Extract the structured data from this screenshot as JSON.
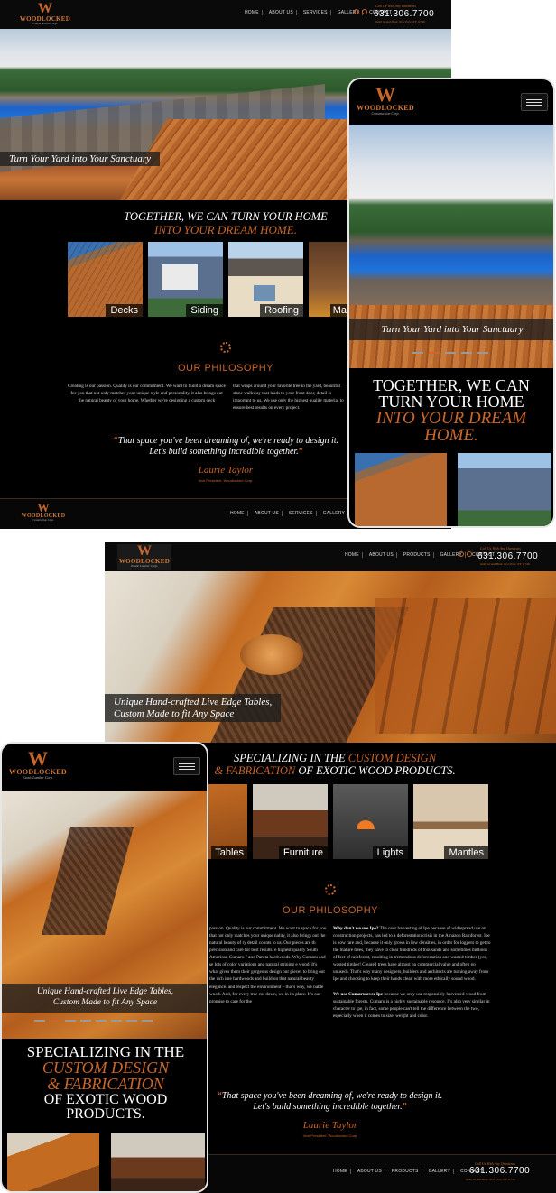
{
  "colors": {
    "accent": "#c9662a",
    "background": "#000000"
  },
  "logo": {
    "initial": "W",
    "name": "WOODLOCKED",
    "sub_construction": "Construction Corp.",
    "sub_lumber": "Exotic Lumber Corp."
  },
  "nav": {
    "items": [
      "HOME",
      "ABOUT US",
      "SERVICES",
      "GALLERY",
      "CONTACT"
    ],
    "items_lumber": [
      "HOME",
      "ABOUT US",
      "PRODUCTS",
      "GALLERY",
      "CONTACT"
    ]
  },
  "contact": {
    "call_label": "Call Us With Any Questions",
    "phone": "631.306.7700",
    "address": "6440 Grand Blvd, New Port, NY 11746"
  },
  "construction": {
    "hero_caption": "Turn Your Yard into Your Sanctuary",
    "headline_white": "TOGETHER, WE CAN TURN YOUR HOME",
    "headline_orange": "INTO YOUR DREAM HOME.",
    "tiles": [
      "Decks",
      "Siding",
      "Roofing",
      "Ma"
    ],
    "philosophy_title": "OUR PHILOSOPHY",
    "para_left": "Creating is our passion. Quality is our commitment. We want to build a dream space for you that not only matches your unique style and personality, it also brings out the natural beauty of your home. Whether we're designing a custom deck",
    "para_right": "that wraps around your favorite tree in the yard, beautiful stone walkway that leads to your front door, detail is important to us. We use only the highest quality material to ensure best results on every project.",
    "quote": "That space you've been dreaming of, we're ready to design it. Let's build something incredible together.",
    "signature": "Laurie Taylor",
    "signature_title": "Vice President, Woodlocked Corp."
  },
  "construction_mobile": {
    "hero_caption": "Turn Your Yard into Your Sanctuary",
    "headline_white": "TOGETHER, WE CAN TURN YOUR HOME",
    "headline_orange": "INTO YOUR DREAM HOME."
  },
  "lumber": {
    "hero_caption_line1": "Unique Hand-crafted Live Edge Tables,",
    "hero_caption_line2": "Custom Made to fit Any Space",
    "headline_1": "SPECIALIZING IN THE",
    "headline_orange_1": "CUSTOM DESIGN",
    "headline_orange_2": "& FABRICATION",
    "headline_2": "OF EXOTIC WOOD PRODUCTS.",
    "tiles": [
      "Tables",
      "Furniture",
      "Lights",
      "Mantles"
    ],
    "philosophy_title": "OUR PHILOSOPHY",
    "para_left": "passion. Quality is our commitment. We want to space for you that not only matches your unique nality, it also brings out the natural beauty of ry detail counts to us. Our pieces are th precision and care for best results. e highest quality South American Cumaru \" and Parota hardwoods. Why Cumaru and se lots of color variations and natural striping e wood. It's what gives them their gorgeous design our pieces to bring out the rich ime hardwoods and build on that natural beauty elegance. and respect the environment – that's why, we nable wood. And, for every tree cut down, we in its place. It's our promise to care for the",
    "para_right_a_bold": "Why don't we use Ipe?",
    "para_right_a": "The over harvesting of Ipe because of widespread use on construction projects, has led to a deforestation crisis in the Amazon Rainforest. Ipe is now rare and, because it only grows in low densities, in order for loggers to get to the mature trees, they have to clear hundreds of thousands and sometimes millions of feet of rainforest, resulting in tremendous deforestation and wasted timber (yes, wasted timber! Cleared trees have almost no commercial value and often go unused). That's why many designers, builders and architects are turning away from Ipe and choosing to keep their hands clean with more ethically sound wood.",
    "para_right_b_bold": "We use Cumaru over Ipe",
    "para_right_b": "because we only use responsibly harvested wood from sustainable forests. Cumaru is a highly sustainable resource. It's also very similar in character to Ipe, in fact, some people can't tell the difference between the two, especially when it comes to size, weight and color.",
    "quote": "That space you've been dreaming of, we're ready to design it. Let's build something incredible together.",
    "signature": "Laurie Taylor",
    "signature_title": "Vice President, Woodlocked Corp."
  },
  "lumber_mobile": {
    "hero_caption_line1": "Unique Hand-crafted Live Edge Tables,",
    "hero_caption_line2": "Custom Made to fit Any Space",
    "headline_1": "SPECIALIZING IN THE",
    "headline_orange_1": "CUSTOM DESIGN",
    "headline_orange_2": "& FABRICATION",
    "headline_2": "OF EXOTIC WOOD PRODUCTS."
  }
}
